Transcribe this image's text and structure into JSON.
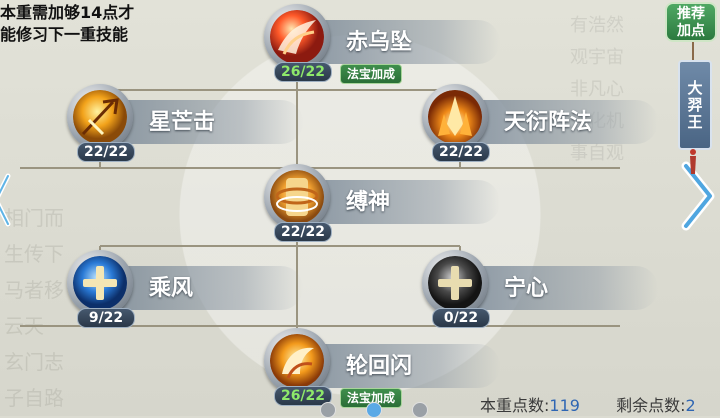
{
  "notice": {
    "line1": "本重需加够14点才",
    "line2": "能修习下一重技能"
  },
  "recommend_button": {
    "line1": "推荐",
    "line2": "加点"
  },
  "character_plaque": "大羿王",
  "skills": [
    {
      "id": "chiwuzhui",
      "name": "赤乌坠",
      "count": "26/22",
      "count_color": "green",
      "tag": "法宝加成",
      "icon": "crimson-bird-icon"
    },
    {
      "id": "xingmangji",
      "name": "星芒击",
      "count": "22/22",
      "count_color": "white",
      "tag": "",
      "icon": "star-trident-icon"
    },
    {
      "id": "tianyanzhenfa",
      "name": "天衍阵法",
      "count": "22/22",
      "count_color": "white",
      "tag": "",
      "icon": "flame-crystal-icon"
    },
    {
      "id": "fushen",
      "name": "缚神",
      "count": "22/22",
      "count_color": "white",
      "tag": "",
      "icon": "binding-scroll-icon"
    },
    {
      "id": "chengfeng",
      "name": "乘风",
      "count": "9/22",
      "count_color": "white",
      "tag": "",
      "icon": "wind-plus-icon"
    },
    {
      "id": "ningxin",
      "name": "宁心",
      "count": "0/22",
      "count_color": "white",
      "tag": "",
      "icon": "calm-plus-icon"
    },
    {
      "id": "lunhuishan",
      "name": "轮回闪",
      "count": "26/22",
      "count_color": "green",
      "tag": "法宝加成",
      "icon": "phoenix-flash-icon"
    }
  ],
  "footer": {
    "points_label": "本重点数:",
    "points_value": "119",
    "remaining_label": "剩余点数:",
    "remaining_value": "2"
  },
  "colors": {
    "accent_green": "#8ee86a",
    "tag_green": "#2f7d3e",
    "points_blue": "#2f66b3"
  }
}
